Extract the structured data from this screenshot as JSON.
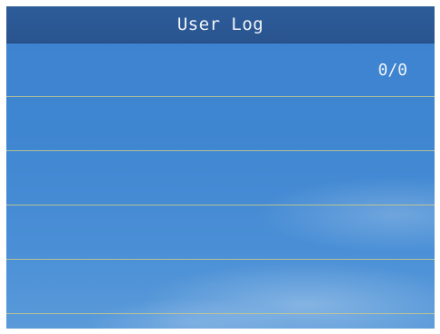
{
  "header": {
    "title": "User Log"
  },
  "pager": {
    "counter": "0/0"
  },
  "log": {
    "entries": [
      "",
      "",
      "",
      "",
      ""
    ]
  },
  "colors": {
    "title_bar": "#2b5894",
    "screen_background": "#3f86d1",
    "divider": "#c9c98a",
    "text": "#f0f4fa"
  }
}
